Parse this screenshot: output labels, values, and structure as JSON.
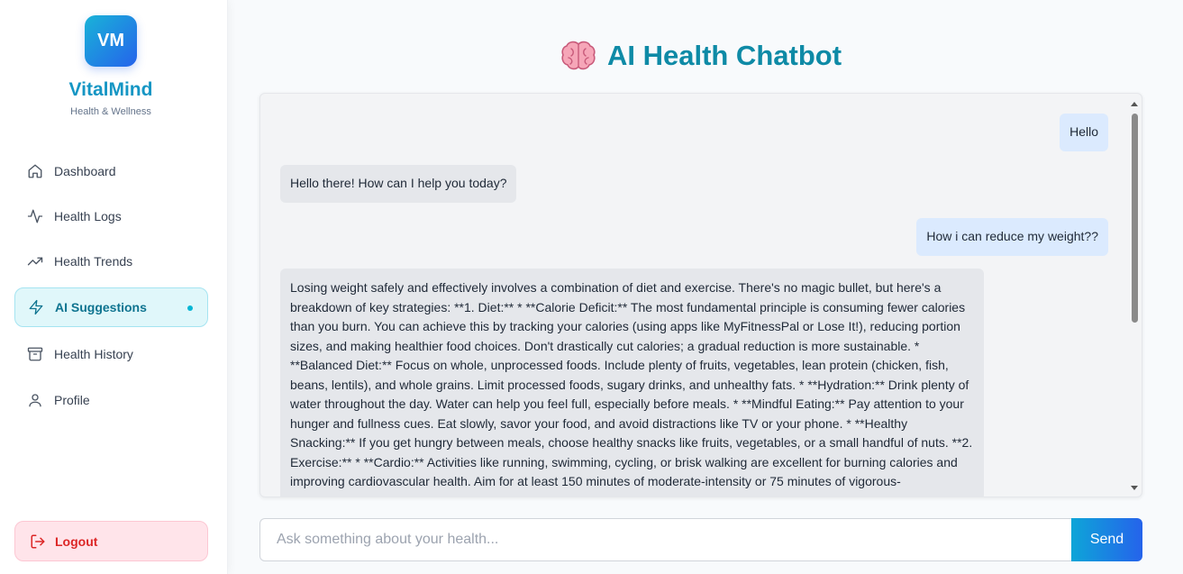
{
  "brand": {
    "logo_text": "VM",
    "name": "VitalMind",
    "tagline": "Health & Wellness"
  },
  "sidebar": {
    "items": [
      {
        "label": "Dashboard",
        "icon": "home-icon",
        "active": false
      },
      {
        "label": "Health Logs",
        "icon": "activity-icon",
        "active": false
      },
      {
        "label": "Health Trends",
        "icon": "trending-up-icon",
        "active": false
      },
      {
        "label": "AI Suggestions",
        "icon": "zap-icon",
        "active": true
      },
      {
        "label": "Health History",
        "icon": "archive-icon",
        "active": false
      },
      {
        "label": "Profile",
        "icon": "user-icon",
        "active": false
      }
    ],
    "logout_label": "Logout"
  },
  "page": {
    "title": "AI Health Chatbot",
    "title_icon": "brain-icon"
  },
  "chat": {
    "messages": [
      {
        "role": "user",
        "text": "Hello"
      },
      {
        "role": "bot",
        "text": "Hello there! How can I help you today?"
      },
      {
        "role": "user",
        "text": "How i can reduce my weight??"
      },
      {
        "role": "bot",
        "text": "Losing weight safely and effectively involves a combination of diet and exercise. There's no magic bullet, but here's a breakdown of key strategies: **1. Diet:** * **Calorie Deficit:** The most fundamental principle is consuming fewer calories than you burn. You can achieve this by tracking your calories (using apps like MyFitnessPal or Lose It!), reducing portion sizes, and making healthier food choices. Don't drastically cut calories; a gradual reduction is more sustainable. * **Balanced Diet:** Focus on whole, unprocessed foods. Include plenty of fruits, vegetables, lean protein (chicken, fish, beans, lentils), and whole grains. Limit processed foods, sugary drinks, and unhealthy fats. * **Hydration:** Drink plenty of water throughout the day. Water can help you feel full, especially before meals. * **Mindful Eating:** Pay attention to your hunger and fullness cues. Eat slowly, savor your food, and avoid distractions like TV or your phone. * **Healthy Snacking:** If you get hungry between meals, choose healthy snacks like fruits, vegetables, or a small handful of nuts. **2. Exercise:** * **Cardio:** Activities like running, swimming, cycling, or brisk walking are excellent for burning calories and improving cardiovascular health. Aim for at least 150 minutes of moderate-intensity or 75 minutes of vigorous-"
      }
    ]
  },
  "input": {
    "placeholder": "Ask something about your health...",
    "value": "",
    "send_label": "Send"
  },
  "colors": {
    "accent": "#0e8aa6",
    "brand_gradient_start": "#19b3d8",
    "brand_gradient_end": "#2563eb",
    "user_bubble": "#dbeafe",
    "bot_bubble": "#e5e7eb",
    "logout": "#dc2626"
  }
}
